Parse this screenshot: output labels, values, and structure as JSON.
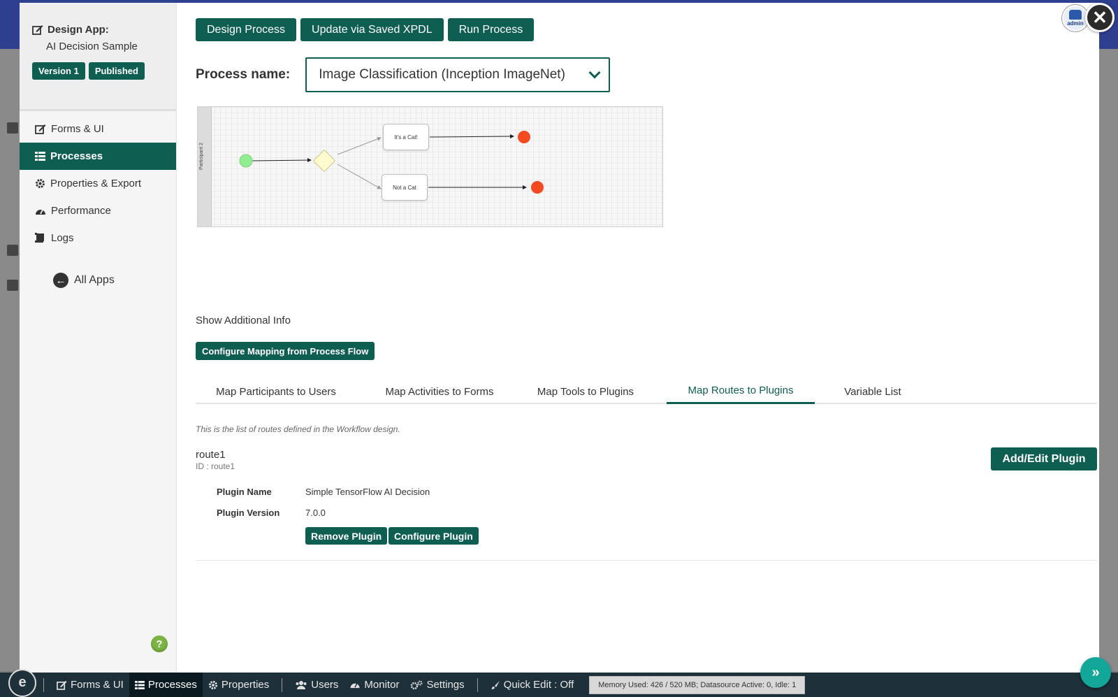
{
  "modal": {
    "app_title": "Design App:",
    "app_name": "AI Decision Sample",
    "version_badge": "Version 1",
    "published_badge": "Published",
    "avatar_label": "admin",
    "close_glyph": "✕"
  },
  "sidebar": {
    "items": [
      {
        "label": "Forms & UI",
        "icon": "edit-icon"
      },
      {
        "label": "Processes",
        "icon": "list-icon"
      },
      {
        "label": "Properties & Export",
        "icon": "gear-icon"
      },
      {
        "label": "Performance",
        "icon": "dashboard-icon"
      },
      {
        "label": "Logs",
        "icon": "scroll-icon"
      }
    ],
    "all_apps": "All Apps",
    "help_glyph": "?"
  },
  "toolbar": {
    "design_process": "Design Process",
    "update_xpdl": "Update via Saved XPDL",
    "run_process": "Run Process"
  },
  "process": {
    "label": "Process name:",
    "selected": "Image Classification (Inception ImageNet)"
  },
  "diagram": {
    "participant": "Participant 2",
    "task_cat": "It's a Cat!",
    "task_not_cat": "Not a Cat"
  },
  "show_info": "Show Additional Info",
  "configure_mapping": "Configure Mapping from Process Flow",
  "tabs": [
    {
      "label": "Map Participants to Users"
    },
    {
      "label": "Map Activities to Forms"
    },
    {
      "label": "Map Tools to Plugins"
    },
    {
      "label": "Map Routes to Plugins"
    },
    {
      "label": "Variable List"
    }
  ],
  "routes": {
    "description": "This is the list of routes defined in the Workflow design.",
    "route_name": "route1",
    "route_id": "ID : route1",
    "add_edit": "Add/Edit Plugin",
    "plugin_name_label": "Plugin Name",
    "plugin_name": "Simple TensorFlow AI Decision",
    "plugin_version_label": "Plugin Version",
    "plugin_version": "7.0.0",
    "remove_plugin": "Remove Plugin",
    "configure_plugin": "Configure Plugin"
  },
  "bottom_bar": {
    "logo_glyph": "e",
    "items": [
      {
        "label": "Forms & UI"
      },
      {
        "label": "Processes"
      },
      {
        "label": "Properties"
      },
      {
        "label": "Users"
      },
      {
        "label": "Monitor"
      },
      {
        "label": "Settings"
      },
      {
        "label": "Quick Edit : Off"
      }
    ],
    "memory": "Memory Used: 426 / 520 MB; Datasource Active: 0, Idle: 1",
    "expand_glyph": "»"
  },
  "colors": {
    "primary": "#0f5e52",
    "start_event": "#90ee90",
    "end_event": "#f44a22",
    "gateway": "#fffbd0"
  }
}
